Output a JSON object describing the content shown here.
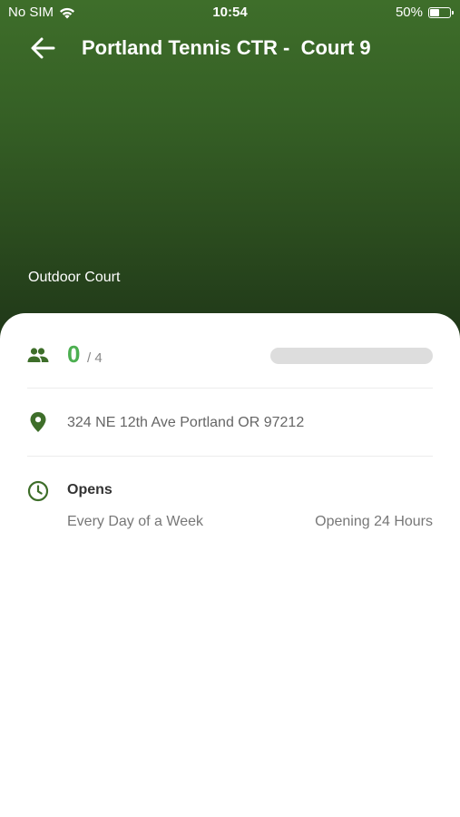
{
  "status_bar": {
    "carrier": "No SIM",
    "time": "10:54",
    "battery_percent": "50%",
    "battery_level": 0.5
  },
  "header": {
    "back_icon": "arrow-left-icon",
    "title": "Portland Tennis CTR -  Court 9",
    "court_type": "Outdoor Court"
  },
  "details": {
    "players": {
      "icon": "people-icon",
      "current": "0",
      "max": "/ 4",
      "fill_fraction": 0
    },
    "address": {
      "icon": "location-pin-icon",
      "text": "324 NE 12th Ave Portland OR 97212"
    },
    "hours": {
      "icon": "clock-icon",
      "label": "Opens",
      "days": "Every Day of a Week",
      "value": "Opening 24 Hours"
    }
  },
  "colors": {
    "accent": "#4caf50",
    "icon": "#3e6e2a",
    "hero_top": "#3e6e2a",
    "hero_bottom": "#1f3618"
  }
}
